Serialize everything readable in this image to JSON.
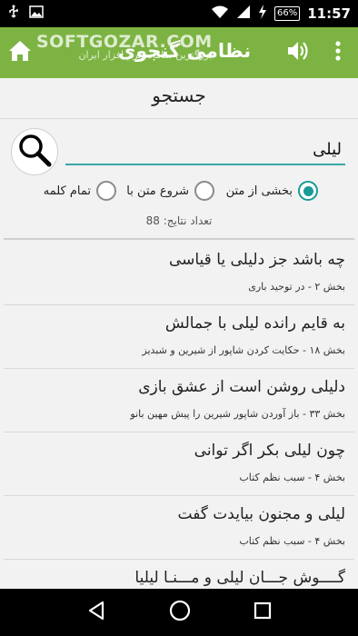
{
  "status_bar": {
    "battery": "66%",
    "clock": "11:57",
    "icons": [
      "usb-icon",
      "image-icon",
      "wifi-icon",
      "signal-icon",
      "charging-icon"
    ]
  },
  "app_bar": {
    "title": "نظامی گنجوی",
    "watermark": "SOFTGOZAR.COM",
    "watermark_sub": "بزرگترین سامانه نرم افزار ایران",
    "color": "#7cb342"
  },
  "search": {
    "section_title": "جستجو",
    "query": "لیلی",
    "options": [
      {
        "label": "بخشی از متن",
        "checked": true
      },
      {
        "label": "شروع متن با",
        "checked": false
      },
      {
        "label": "تمام کلمه",
        "checked": false
      }
    ],
    "results_count_label": "تعداد نتایج: 88",
    "accent": "#199b98"
  },
  "results": [
    {
      "verse": "چه باشد جز دلیلی یا قیاسی",
      "source": "بخش ۲ - در توحید باری"
    },
    {
      "verse": "به قایم رانده لیلی با جمالش",
      "source": "بخش ۱۸ - حکایت کردن شاپور از شیرین و شبدیز"
    },
    {
      "verse": "دلیلی روشن است از عشق بازی",
      "source": "بخش ۳۳ - باز آوردن شاپور شیرین را پیش مهین بانو"
    },
    {
      "verse": "چون لیلی بکر اگر توانی",
      "source": "بخش ۴ - سبب نظم کتاب"
    },
    {
      "verse": "لیلی و مجنون بیایدت گفت",
      "source": "بخش ۴ - سبب نظم کتاب"
    },
    {
      "verse": "گــــوش جـــان لیلی و مـــنـا لیلیا",
      "source": ""
    }
  ]
}
